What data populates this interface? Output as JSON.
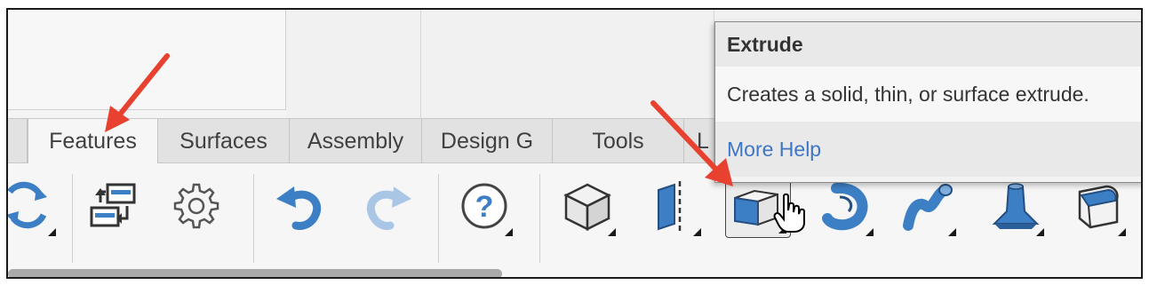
{
  "tabs": [
    {
      "label": "",
      "active": false
    },
    {
      "label": "Features",
      "active": true
    },
    {
      "label": "Surfaces",
      "active": false
    },
    {
      "label": "Assembly",
      "active": false
    },
    {
      "label": "Design G",
      "active": false
    },
    {
      "label": "Tools",
      "active": false
    },
    {
      "label": "L",
      "active": false
    }
  ],
  "toolbar": {
    "tools": [
      {
        "name": "partial-arrows-icon",
        "flyout": true
      },
      {
        "name": "pattern-sketch-icon",
        "flyout": false
      },
      {
        "name": "gear-icon",
        "flyout": false
      },
      {
        "name": "undo-icon",
        "flyout": false
      },
      {
        "name": "redo-icon",
        "flyout": false
      },
      {
        "name": "help-icon",
        "flyout": true
      },
      {
        "name": "cube-icon",
        "flyout": true
      },
      {
        "name": "mirror-plane-icon",
        "flyout": true
      },
      {
        "name": "extrude-icon",
        "flyout": true,
        "selected": true
      },
      {
        "name": "revolve-icon",
        "flyout": true
      },
      {
        "name": "sweep-icon",
        "flyout": true
      },
      {
        "name": "loft-icon",
        "flyout": true
      },
      {
        "name": "fillet-icon",
        "flyout": true
      }
    ]
  },
  "tooltip": {
    "title": "Extrude",
    "description": "Creates a solid, thin, or surface extrude.",
    "help_link": "More Help"
  },
  "colors": {
    "annotation_arrow": "#e8412f",
    "icon_blue": "#3d7fc4",
    "help_link": "#3e76c5"
  }
}
